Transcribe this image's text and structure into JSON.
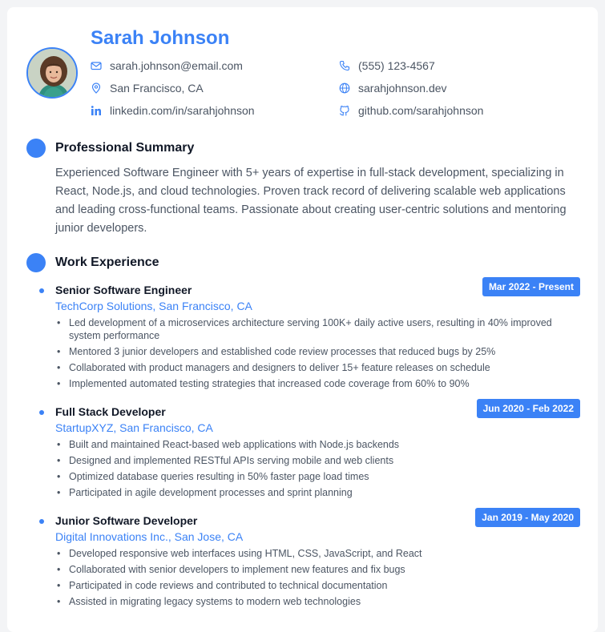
{
  "profile": {
    "name": "Sarah Johnson",
    "email": "sarah.johnson@email.com",
    "phone": "(555) 123-4567",
    "location": "San Francisco, CA",
    "website": "sarahjohnson.dev",
    "linkedin": "linkedin.com/in/sarahjohnson",
    "github": "github.com/sarahjohnson"
  },
  "summary": {
    "title": "Professional Summary",
    "text": "Experienced Software Engineer with 5+ years of expertise in full-stack development, specializing in React, Node.js, and cloud technologies. Proven track record of delivering scalable web applications and leading cross-functional teams. Passionate about creating user-centric solutions and mentoring junior developers."
  },
  "experience": {
    "title": "Work Experience",
    "jobs": [
      {
        "title": "Senior Software Engineer",
        "company": "TechCorp Solutions, San Francisco, CA",
        "dates": "Mar 2022 - Present",
        "bullets": [
          "Led development of a microservices architecture serving 100K+ daily active users, resulting in 40% improved system performance",
          "Mentored 3 junior developers and established code review processes that reduced bugs by 25%",
          "Collaborated with product managers and designers to deliver 15+ feature releases on schedule",
          "Implemented automated testing strategies that increased code coverage from 60% to 90%"
        ]
      },
      {
        "title": "Full Stack Developer",
        "company": "StartupXYZ, San Francisco, CA",
        "dates": "Jun 2020 - Feb 2022",
        "bullets": [
          "Built and maintained React-based web applications with Node.js backends",
          "Designed and implemented RESTful APIs serving mobile and web clients",
          "Optimized database queries resulting in 50% faster page load times",
          "Participated in agile development processes and sprint planning"
        ]
      },
      {
        "title": "Junior Software Developer",
        "company": "Digital Innovations Inc., San Jose, CA",
        "dates": "Jan 2019 - May 2020",
        "bullets": [
          "Developed responsive web interfaces using HTML, CSS, JavaScript, and React",
          "Collaborated with senior developers to implement new features and fix bugs",
          "Participated in code reviews and contributed to technical documentation",
          "Assisted in migrating legacy systems to modern web technologies"
        ]
      }
    ]
  },
  "colors": {
    "accent": "#3b82f6",
    "text": "#4b5563",
    "heading": "#111827"
  }
}
